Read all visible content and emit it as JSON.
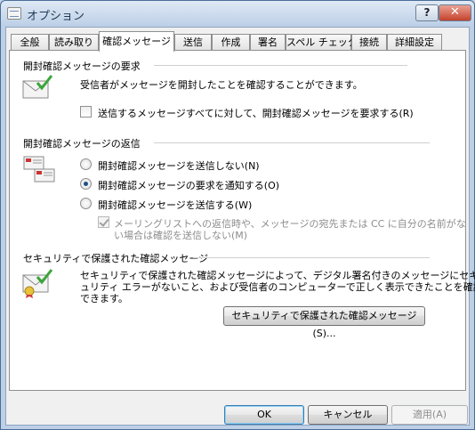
{
  "window": {
    "title": "オプション",
    "help_label": "?",
    "close_label": "✕"
  },
  "tabs": [
    {
      "label": "全般",
      "active": false
    },
    {
      "label": "読み取り",
      "active": false
    },
    {
      "label": "確認メッセージ",
      "active": true
    },
    {
      "label": "送信",
      "active": false
    },
    {
      "label": "作成",
      "active": false
    },
    {
      "label": "署名",
      "active": false
    },
    {
      "label": "スペル チェック",
      "active": false
    },
    {
      "label": "接続",
      "active": false
    },
    {
      "label": "詳細設定",
      "active": false
    }
  ],
  "request_section": {
    "title": "開封確認メッセージの要求",
    "description": "受信者がメッセージを開封したことを確認することができます。",
    "checkbox_label": "送信するメッセージすべてに対して、開封確認メッセージを要求する(R)",
    "checkbox_checked": false
  },
  "reply_section": {
    "title": "開封確認メッセージの返信",
    "options": [
      {
        "label": "開封確認メッセージを送信しない(N)",
        "selected": false
      },
      {
        "label": "開封確認メッセージの要求を通知する(O)",
        "selected": true
      },
      {
        "label": "開封確認メッセージを送信する(W)",
        "selected": false
      }
    ],
    "sub_checkbox_label_line1": "メーリングリストへの返信時や、メッセージの宛先または CC に自分の名前がな",
    "sub_checkbox_label_line2": "い場合は確認を送信しない(M)",
    "sub_checkbox_checked": true,
    "sub_checkbox_disabled": true
  },
  "secure_section": {
    "title": "セキュリティで保護された確認メッセージ",
    "description_line1": "セキュリティで保護された確認メッセージによって、デジタル署名付きのメッセージにセキ",
    "description_line2": "ュリティ エラーがないこと、および受信者のコンピューターで正しく表示できたことを確認",
    "description_line3": "できます。",
    "button_label": "セキュリティで保護された確認メッセージ(S)..."
  },
  "footer": {
    "ok_label": "OK",
    "cancel_label": "キャンセル",
    "apply_label": "適用(A)"
  }
}
